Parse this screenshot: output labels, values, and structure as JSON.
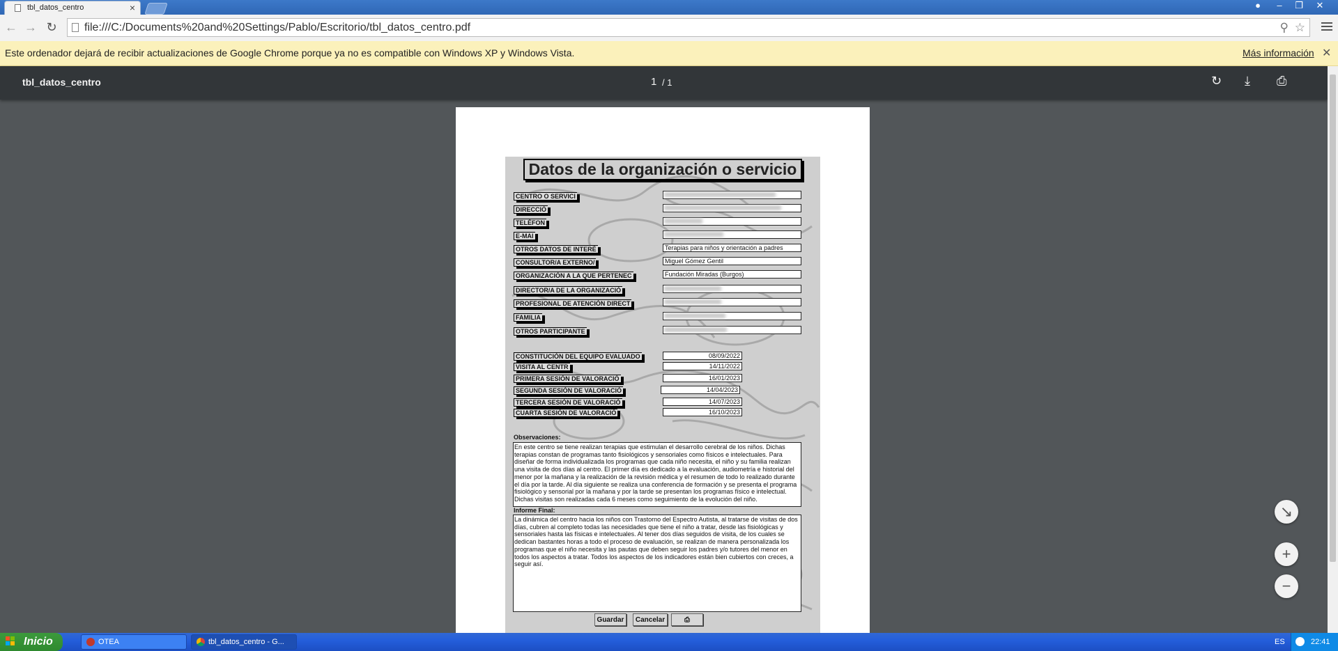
{
  "browser": {
    "tab_title": "tbl_datos_centro",
    "url": "file:///C:/Documents%20and%20Settings/Pablo/Escritorio/tbl_datos_centro.pdf"
  },
  "infobar": {
    "message": "Este ordenador dejará de recibir actualizaciones de Google Chrome porque ya no es compatible con Windows XP y Windows Vista.",
    "link": "Más información"
  },
  "viewer": {
    "title": "tbl_datos_centro",
    "page_current": "1",
    "page_total": "/ 1"
  },
  "form": {
    "title": "Datos de la organización o servicio",
    "fields": [
      {
        "label": "CENTRO O SERVICI",
        "value": ""
      },
      {
        "label": "DIRECCIÓ",
        "value": ""
      },
      {
        "label": "TELÉFON",
        "value": ""
      },
      {
        "label": "E-MAI",
        "value": ""
      },
      {
        "label": "OTROS DATOS DE INTERÉ",
        "value": "Terapias para niños y orientación a padres"
      },
      {
        "label": "CONSULTOR/A EXTERNO/",
        "value": "Miguel Gómez Gentil"
      },
      {
        "label": "ORGANIZACIÓN A LA QUE PERTENEC",
        "value": "Fundación Miradas (Burgos)"
      },
      {
        "label": "DIRECTOR/A DE LA ORGANIZACIÓ",
        "value": ""
      },
      {
        "label": "PROFESIONAL DE ATENCIÓN DIRECT",
        "value": ""
      },
      {
        "label": "FAMILIA",
        "value": ""
      },
      {
        "label": "OTROS PARTICIPANTE",
        "value": ""
      }
    ],
    "dates": [
      {
        "label": "CONSTITUCIÓN DEL EQUIPO EVALUADO",
        "value": "08/09/2022"
      },
      {
        "label": "VISITA AL CENTR",
        "value": "14/11/2022"
      },
      {
        "label": "PRIMERA SESIÓN DE VALORACIÓ",
        "value": "16/01/2023"
      },
      {
        "label": "SEGUNDA SESIÓN DE VALORACIÓ",
        "value": "14/04/2023"
      },
      {
        "label": "TERCERA SESIÓN DE VALORACIÓ",
        "value": "14/07/2023"
      },
      {
        "label": "CUARTA SESIÓN DE VALORACIÓ",
        "value": "16/10/2023"
      }
    ],
    "observaciones_label": "Observaciones:",
    "observaciones": "En este centro se tiene realizan terapias que estimulan el desarrollo cerebral de los niños. Dichas terapias constan de programas tanto fisiológicos y sensoriales como físicos e intelectuales. Para diseñar de forma individualizada los programas que cada niño necesita, el niño y su familia realizan una visita de dos días al centro. El primer día es dedicado a la evaluación, audiometría e historial del menor por la mañana y la realización de la revisión médica y el resumen de todo lo realizado durante el día por la tarde. Al día siguiente se realiza una conferencia de formación y se presenta el programa fisiológico y sensorial por la mañana y por la tarde se presentan los programas físico e intelectual. Dichas visitas son realizadas cada 6 meses como seguimiento de la evolución del niño.",
    "informe_label": "Informe Final:",
    "informe": "La dinámica del centro hacia los niños con Trastorno del Espectro Autista, al tratarse de visitas de dos días, cubren al completo todas las necesidades que tiene el niño a tratar, desde las fisiológicas y sensoriales hasta las físicas e intelectuales. Al tener dos días seguidos de visita, de los cuales se dedican bastantes horas a todo el proceso de evaluación, se realizan de manera personalizada los programas que el niño necesita y las pautas que deben seguir los padres y/o tutores del menor en todos los aspectos a tratar. Todos los aspectos de los indicadores están bien cubiertos con creces, a seguir así.",
    "save_label": "Guardar",
    "cancel_label": "Cancelar"
  },
  "taskbar": {
    "start_label": "Inicio",
    "items": [
      {
        "label": "OTEA"
      },
      {
        "label": "tbl_datos_centro - G..."
      }
    ],
    "lang": "ES",
    "clock": "22:41"
  }
}
